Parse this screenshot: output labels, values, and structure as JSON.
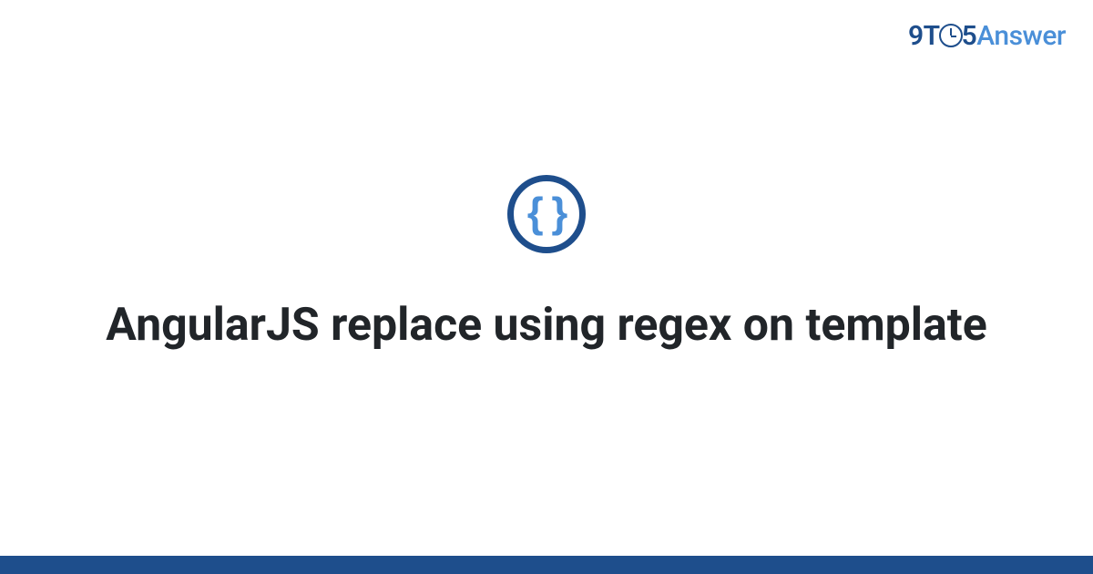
{
  "brand": {
    "part1": "9T",
    "part2": "5",
    "part3": "Answer"
  },
  "icon": {
    "braces": "{ }"
  },
  "main": {
    "title": "AngularJS replace using regex on template"
  },
  "colors": {
    "primary": "#1e4e8c",
    "accent": "#4a8fd8",
    "text": "#212529"
  }
}
